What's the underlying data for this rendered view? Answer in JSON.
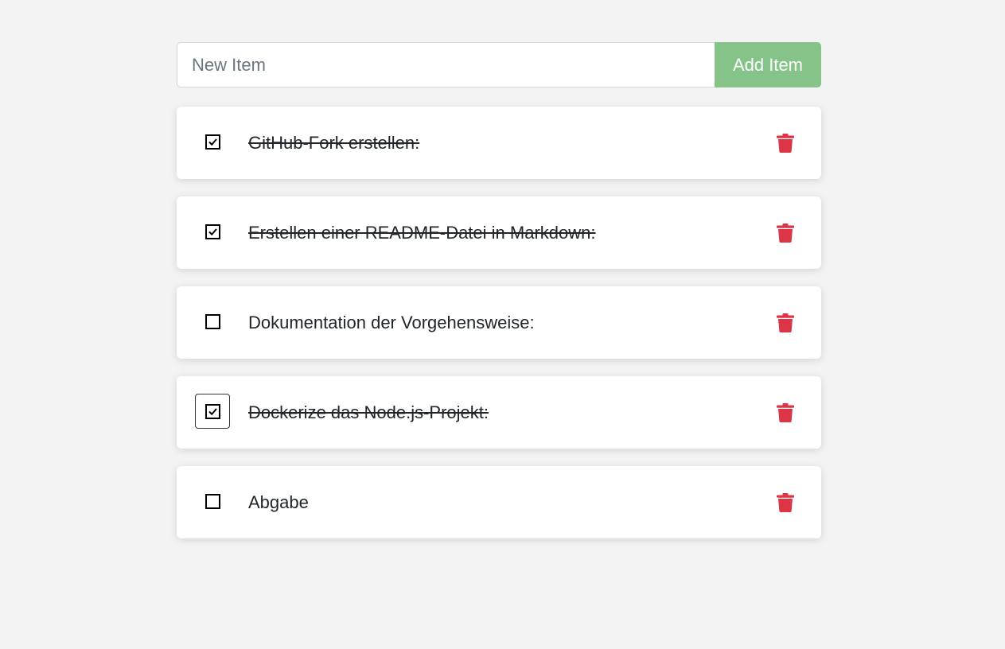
{
  "form": {
    "input_placeholder": "New Item",
    "input_value": "",
    "add_label": "Add Item"
  },
  "colors": {
    "background": "#f3f3f3",
    "add_button": "#85c388",
    "delete_icon": "#dc3545"
  },
  "items": [
    {
      "name": "GitHub-Fork erstellen:",
      "completed": true,
      "icon": "check-square-icon"
    },
    {
      "name": "Erstellen einer README-Datei in Markdown:",
      "completed": true,
      "icon": "check-square-icon"
    },
    {
      "name": "Dokumentation der Vorgehensweise:",
      "completed": false,
      "icon": "square-icon"
    },
    {
      "name": "Dockerize das Node.js-Projekt:",
      "completed": true,
      "icon": "check-square-icon"
    },
    {
      "name": "Abgabe",
      "completed": false,
      "icon": "square-icon"
    }
  ]
}
